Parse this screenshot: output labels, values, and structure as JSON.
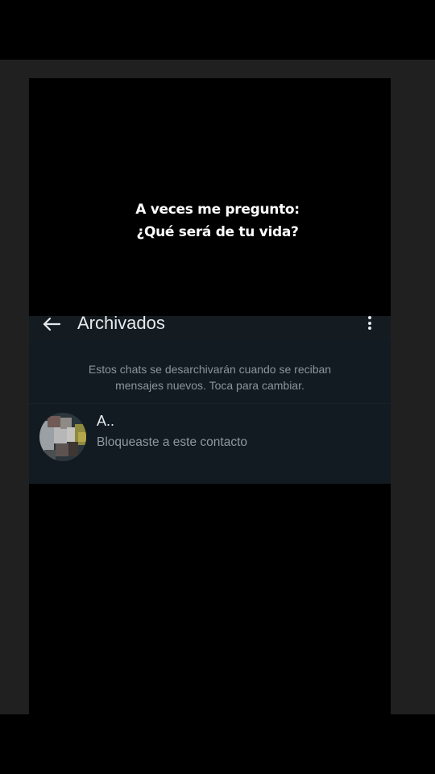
{
  "caption": {
    "line1": "A veces me pregunto:",
    "line2": "¿Qué será de tu vida?"
  },
  "screen": {
    "header": {
      "back_icon": "arrow-left-icon",
      "title": "Archivados",
      "menu_icon": "more-vertical-icon"
    },
    "notice": {
      "line1": "Estos chats se desarchivarán cuando se reciban",
      "line2": "mensajes nuevos. Toca para cambiar."
    },
    "chats": [
      {
        "name": "A..",
        "preview": "Bloqueaste a este contacto",
        "avatar": "pixelated-avatar"
      }
    ]
  },
  "colors": {
    "background": "#000000",
    "letterbox": "#202020",
    "screen_bg": "#121b21",
    "text_primary": "#e9edef",
    "text_secondary": "#8d989f"
  }
}
